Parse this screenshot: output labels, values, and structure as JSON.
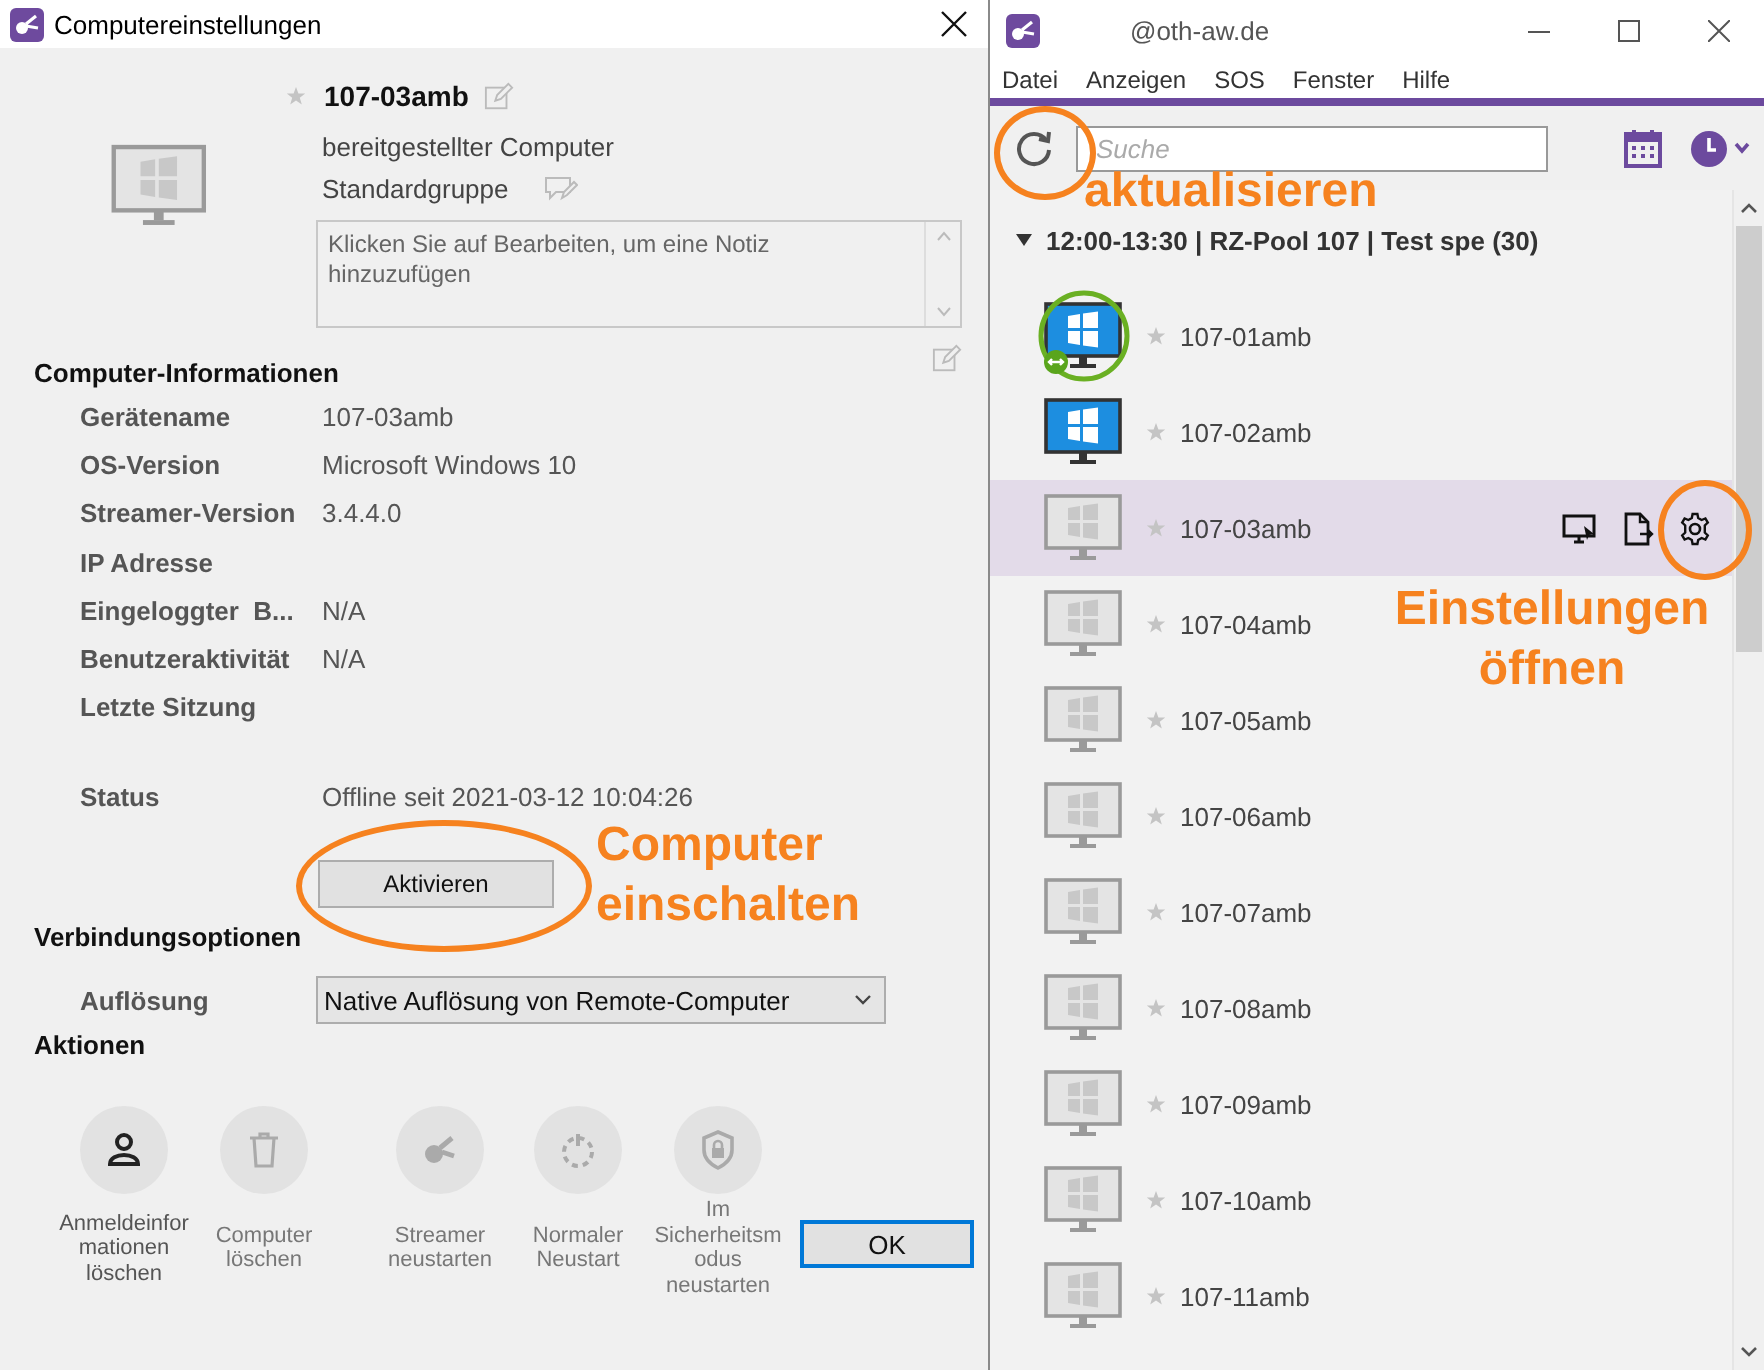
{
  "dialog": {
    "title": "Computereinstellungen",
    "computer": {
      "name": "107-03amb",
      "favorite": false,
      "type": "bereitgestellter Computer",
      "group": "Standardgruppe",
      "note_placeholder": "Klicken Sie auf Bearbeiten, um eine Notiz hinzuzufügen"
    },
    "info": {
      "heading": "Computer-Informationen",
      "rows": [
        {
          "label": "Gerätename",
          "value": "107-03amb"
        },
        {
          "label": "OS-Version",
          "value": "Microsoft Windows 10"
        },
        {
          "label": "Streamer-Version",
          "value": "3.4.4.0"
        },
        {
          "label": "IP Adresse"
        },
        {
          "label": "Eingeloggter  B...",
          "value": "N/A"
        },
        {
          "label": "Benutzeraktivität",
          "value": "N/A"
        },
        {
          "label": "Letzte Sitzung"
        }
      ]
    },
    "status": {
      "label": "Status",
      "value": "Offline seit 2021-03-12 10:04:26",
      "button": "Aktivieren"
    },
    "connection": {
      "heading": "Verbindungsoptionen",
      "label": "Auflösung",
      "value": "Native Auflösung von Remote-Computer"
    },
    "actions": {
      "heading": "Aktionen",
      "items": [
        {
          "kind": "user",
          "disabled": false,
          "lines": [
            "Anmeldeinfor",
            "mationen",
            "löschen"
          ]
        },
        {
          "kind": "trash",
          "disabled": true,
          "lines": [
            "Computer",
            "löschen"
          ]
        },
        {
          "kind": "streamer",
          "disabled": true,
          "lines": [
            "Streamer",
            "neustarten"
          ]
        },
        {
          "kind": "power",
          "disabled": true,
          "lines": [
            "Normaler",
            "Neustart"
          ]
        },
        {
          "kind": "shield",
          "disabled": true,
          "lines": [
            "Im",
            "Sicherheitsm",
            "odus",
            "neustarten"
          ]
        }
      ]
    },
    "ok": "OK"
  },
  "window": {
    "title": "@oth-aw.de",
    "menu": [
      "Datei",
      "Anzeigen",
      "SOS",
      "Fenster",
      "Hilfe"
    ],
    "search": {
      "placeholder": "Suche"
    },
    "group": {
      "label": "12:00-13:30 | RZ-Pool 107 | Test spe (30)",
      "expanded": true,
      "computers": [
        {
          "name": "107-01amb",
          "kind": "connected",
          "favorite": false,
          "selected": false
        },
        {
          "name": "107-02amb",
          "kind": "online",
          "favorite": false,
          "selected": false
        },
        {
          "name": "107-03amb",
          "kind": "offline",
          "favorite": false,
          "selected": true
        },
        {
          "name": "107-04amb",
          "kind": "offline",
          "favorite": false,
          "selected": false
        },
        {
          "name": "107-05amb",
          "kind": "offline",
          "favorite": false,
          "selected": false
        },
        {
          "name": "107-06amb",
          "kind": "offline",
          "favorite": false,
          "selected": false
        },
        {
          "name": "107-07amb",
          "kind": "offline",
          "favorite": false,
          "selected": false
        },
        {
          "name": "107-08amb",
          "kind": "offline",
          "favorite": false,
          "selected": false
        },
        {
          "name": "107-09amb",
          "kind": "offline",
          "favorite": false,
          "selected": false
        },
        {
          "name": "107-10amb",
          "kind": "offline",
          "favorite": false,
          "selected": false
        },
        {
          "name": "107-11amb",
          "kind": "offline",
          "favorite": false,
          "selected": false
        }
      ]
    }
  },
  "annotations": [
    {
      "lines": [
        "aktualisieren"
      ]
    },
    {
      "lines": [
        "Einstellungen",
        "öffnen"
      ]
    },
    {
      "lines": [
        "Computer",
        "einschalten"
      ]
    }
  ]
}
